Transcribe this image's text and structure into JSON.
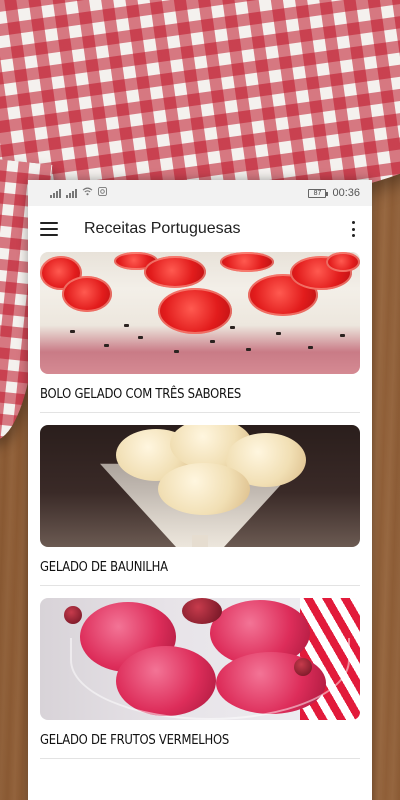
{
  "status_bar": {
    "time": "00:36",
    "battery": "87",
    "icons": [
      "signal-icon",
      "wifi-icon",
      "sync-icon",
      "battery-icon"
    ]
  },
  "app_bar": {
    "title": "Receitas Portuguesas",
    "icons": [
      "menu-icon",
      "more-vert-icon"
    ]
  },
  "recipes": [
    {
      "title": "BOLO GELADO COM TRÊS SABORES"
    },
    {
      "title": "GELADO DE BAUNILHA"
    },
    {
      "title": "GELADO DE FRUTOS VERMELHOS"
    }
  ],
  "colors": {
    "accent_red": "#e21c1c",
    "wood": "#a36d43"
  }
}
